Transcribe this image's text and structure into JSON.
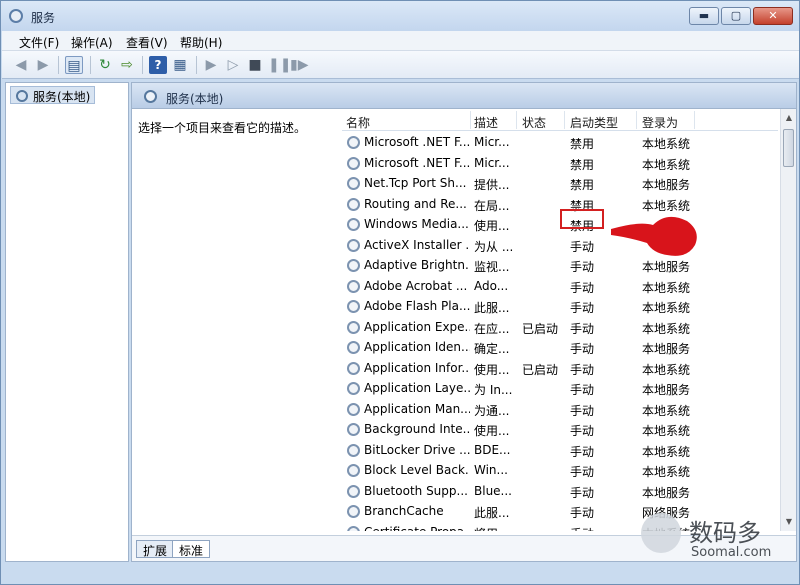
{
  "window": {
    "title": "服务",
    "minimize": "▬",
    "maximize": "▢",
    "close": "✕"
  },
  "menu": [
    "文件(F)",
    "操作(A)",
    "查看(V)",
    "帮助(H)"
  ],
  "toolbar": {
    "help_label": "?"
  },
  "tree": {
    "item": "服务(本地)"
  },
  "pane": {
    "header": "服务(本地)",
    "description": "选择一个项目来查看它的描述。"
  },
  "columns": {
    "name": "名称",
    "desc": "描述",
    "status": "状态",
    "startup": "启动类型",
    "logon": "登录为"
  },
  "rows": [
    {
      "name": "Microsoft .NET F...",
      "desc": "Micr...",
      "status": "",
      "startup": "禁用",
      "logon": "本地系统"
    },
    {
      "name": "Microsoft .NET F...",
      "desc": "Micr...",
      "status": "",
      "startup": "禁用",
      "logon": "本地系统"
    },
    {
      "name": "Net.Tcp Port Sh...",
      "desc": "提供...",
      "status": "",
      "startup": "禁用",
      "logon": "本地服务"
    },
    {
      "name": "Routing and Re...",
      "desc": "在局...",
      "status": "",
      "startup": "禁用",
      "logon": "本地系统"
    },
    {
      "name": "Windows Media...",
      "desc": "使用...",
      "status": "",
      "startup": "禁用",
      "logon": ""
    },
    {
      "name": "ActiveX Installer ...",
      "desc": "为从 ...",
      "status": "",
      "startup": "手动",
      "logon": ""
    },
    {
      "name": "Adaptive Brightn...",
      "desc": "监视...",
      "status": "",
      "startup": "手动",
      "logon": "本地服务"
    },
    {
      "name": "Adobe Acrobat ...",
      "desc": "Ado...",
      "status": "",
      "startup": "手动",
      "logon": "本地系统"
    },
    {
      "name": "Adobe Flash Pla...",
      "desc": "此服...",
      "status": "",
      "startup": "手动",
      "logon": "本地系统"
    },
    {
      "name": "Application Expe...",
      "desc": "在应...",
      "status": "已启动",
      "startup": "手动",
      "logon": "本地系统"
    },
    {
      "name": "Application Iden...",
      "desc": "确定...",
      "status": "",
      "startup": "手动",
      "logon": "本地服务"
    },
    {
      "name": "Application Infor...",
      "desc": "使用...",
      "status": "已启动",
      "startup": "手动",
      "logon": "本地系统"
    },
    {
      "name": "Application Laye...",
      "desc": "为 In...",
      "status": "",
      "startup": "手动",
      "logon": "本地服务"
    },
    {
      "name": "Application Man...",
      "desc": "为通...",
      "status": "",
      "startup": "手动",
      "logon": "本地系统"
    },
    {
      "name": "Background Inte...",
      "desc": "使用...",
      "status": "",
      "startup": "手动",
      "logon": "本地系统"
    },
    {
      "name": "BitLocker Drive ...",
      "desc": "BDE...",
      "status": "",
      "startup": "手动",
      "logon": "本地系统"
    },
    {
      "name": "Block Level Back...",
      "desc": "Win...",
      "status": "",
      "startup": "手动",
      "logon": "本地系统"
    },
    {
      "name": "Bluetooth Supp...",
      "desc": "Blue...",
      "status": "",
      "startup": "手动",
      "logon": "本地服务"
    },
    {
      "name": "BranchCache",
      "desc": "此服...",
      "status": "",
      "startup": "手动",
      "logon": "网络服务"
    },
    {
      "name": "Certificate Propa...",
      "desc": "将用...",
      "status": "",
      "startup": "手动",
      "logon": "本地系统"
    }
  ],
  "tabs": [
    "扩展",
    "标准"
  ],
  "watermark": {
    "brand": "数码多",
    "site": "Soomal.com"
  },
  "colors": {
    "highlight": "#d32020",
    "annotation": "#d8141b"
  }
}
